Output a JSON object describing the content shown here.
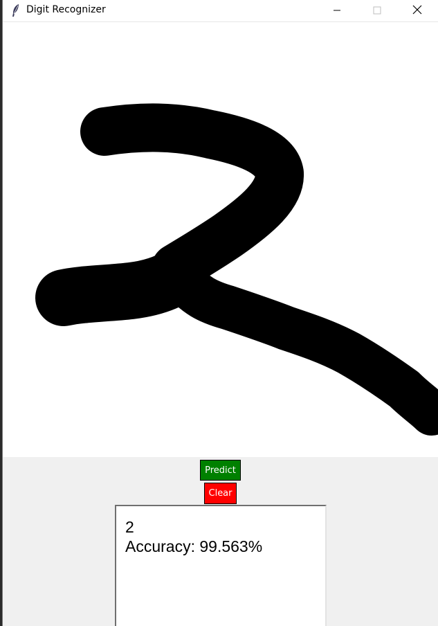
{
  "window": {
    "title": "Digit Recognizer",
    "icon": "feather-icon",
    "controls": [
      "minimize-icon",
      "maximize-icon",
      "close-icon"
    ]
  },
  "canvas": {
    "background": "#ffffff",
    "stroke_color": "#000000",
    "drawn_digit": "2"
  },
  "buttons": {
    "predict_label": "Predict",
    "predict_color": "#008000",
    "clear_label": "Clear",
    "clear_color": "#ff0000"
  },
  "result": {
    "prediction": "2",
    "accuracy_text": "Accuracy: 99.563%"
  }
}
